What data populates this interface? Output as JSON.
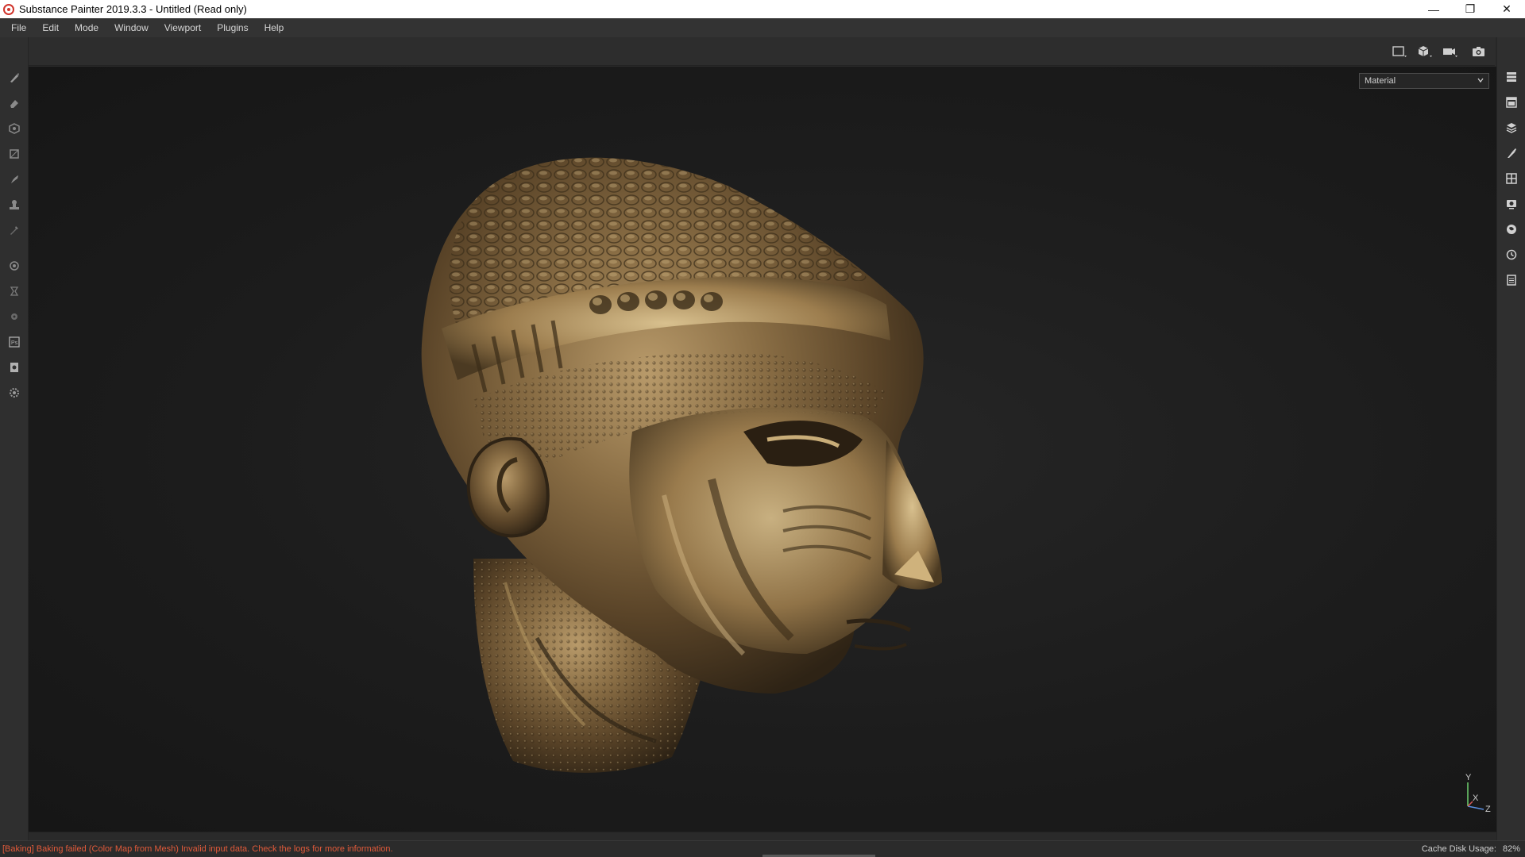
{
  "window": {
    "title": "Substance Painter 2019.3.3 - Untitled (Read only)",
    "controls": {
      "minimize": "—",
      "restore": "❐",
      "close": "✕"
    },
    "icon": "substance-painter-logo"
  },
  "menu": {
    "items": [
      "File",
      "Edit",
      "Mode",
      "Window",
      "Viewport",
      "Plugins",
      "Help"
    ]
  },
  "viewport": {
    "channel_select": {
      "value": "Material"
    },
    "toolbar_icons": [
      "viewport-2d-3d-icon",
      "mesh-display-icon",
      "camera-icon",
      "screenshot-icon"
    ],
    "axis": {
      "y": "Y",
      "x": "X",
      "z": "Z"
    },
    "model": "bronze-head-sculpture"
  },
  "left_toolbar": {
    "tools": [
      "paint-brush-icon",
      "eraser-icon",
      "projection-icon",
      "polygon-fill-icon",
      "smudge-icon",
      "clone-stamp-icon",
      "color-picker-icon",
      "bake-icon",
      "iray-icon",
      "substance-icon",
      "photoshop-export-icon",
      "export-icon",
      "settings-icon"
    ]
  },
  "right_toolbar": {
    "panels": [
      "layers-list-icon",
      "texture-set-icon",
      "layer-stack-icon",
      "properties-brush-icon",
      "uv-grid-icon",
      "display-settings-icon",
      "shelf-icon",
      "history-icon",
      "log-icon"
    ]
  },
  "status": {
    "message": "[Baking] Baking failed (Color Map from Mesh) Invalid input data. Check the logs for more information.",
    "message_color": "#e05a3a",
    "cache_label": "Cache Disk Usage:",
    "cache_value": "82%"
  }
}
